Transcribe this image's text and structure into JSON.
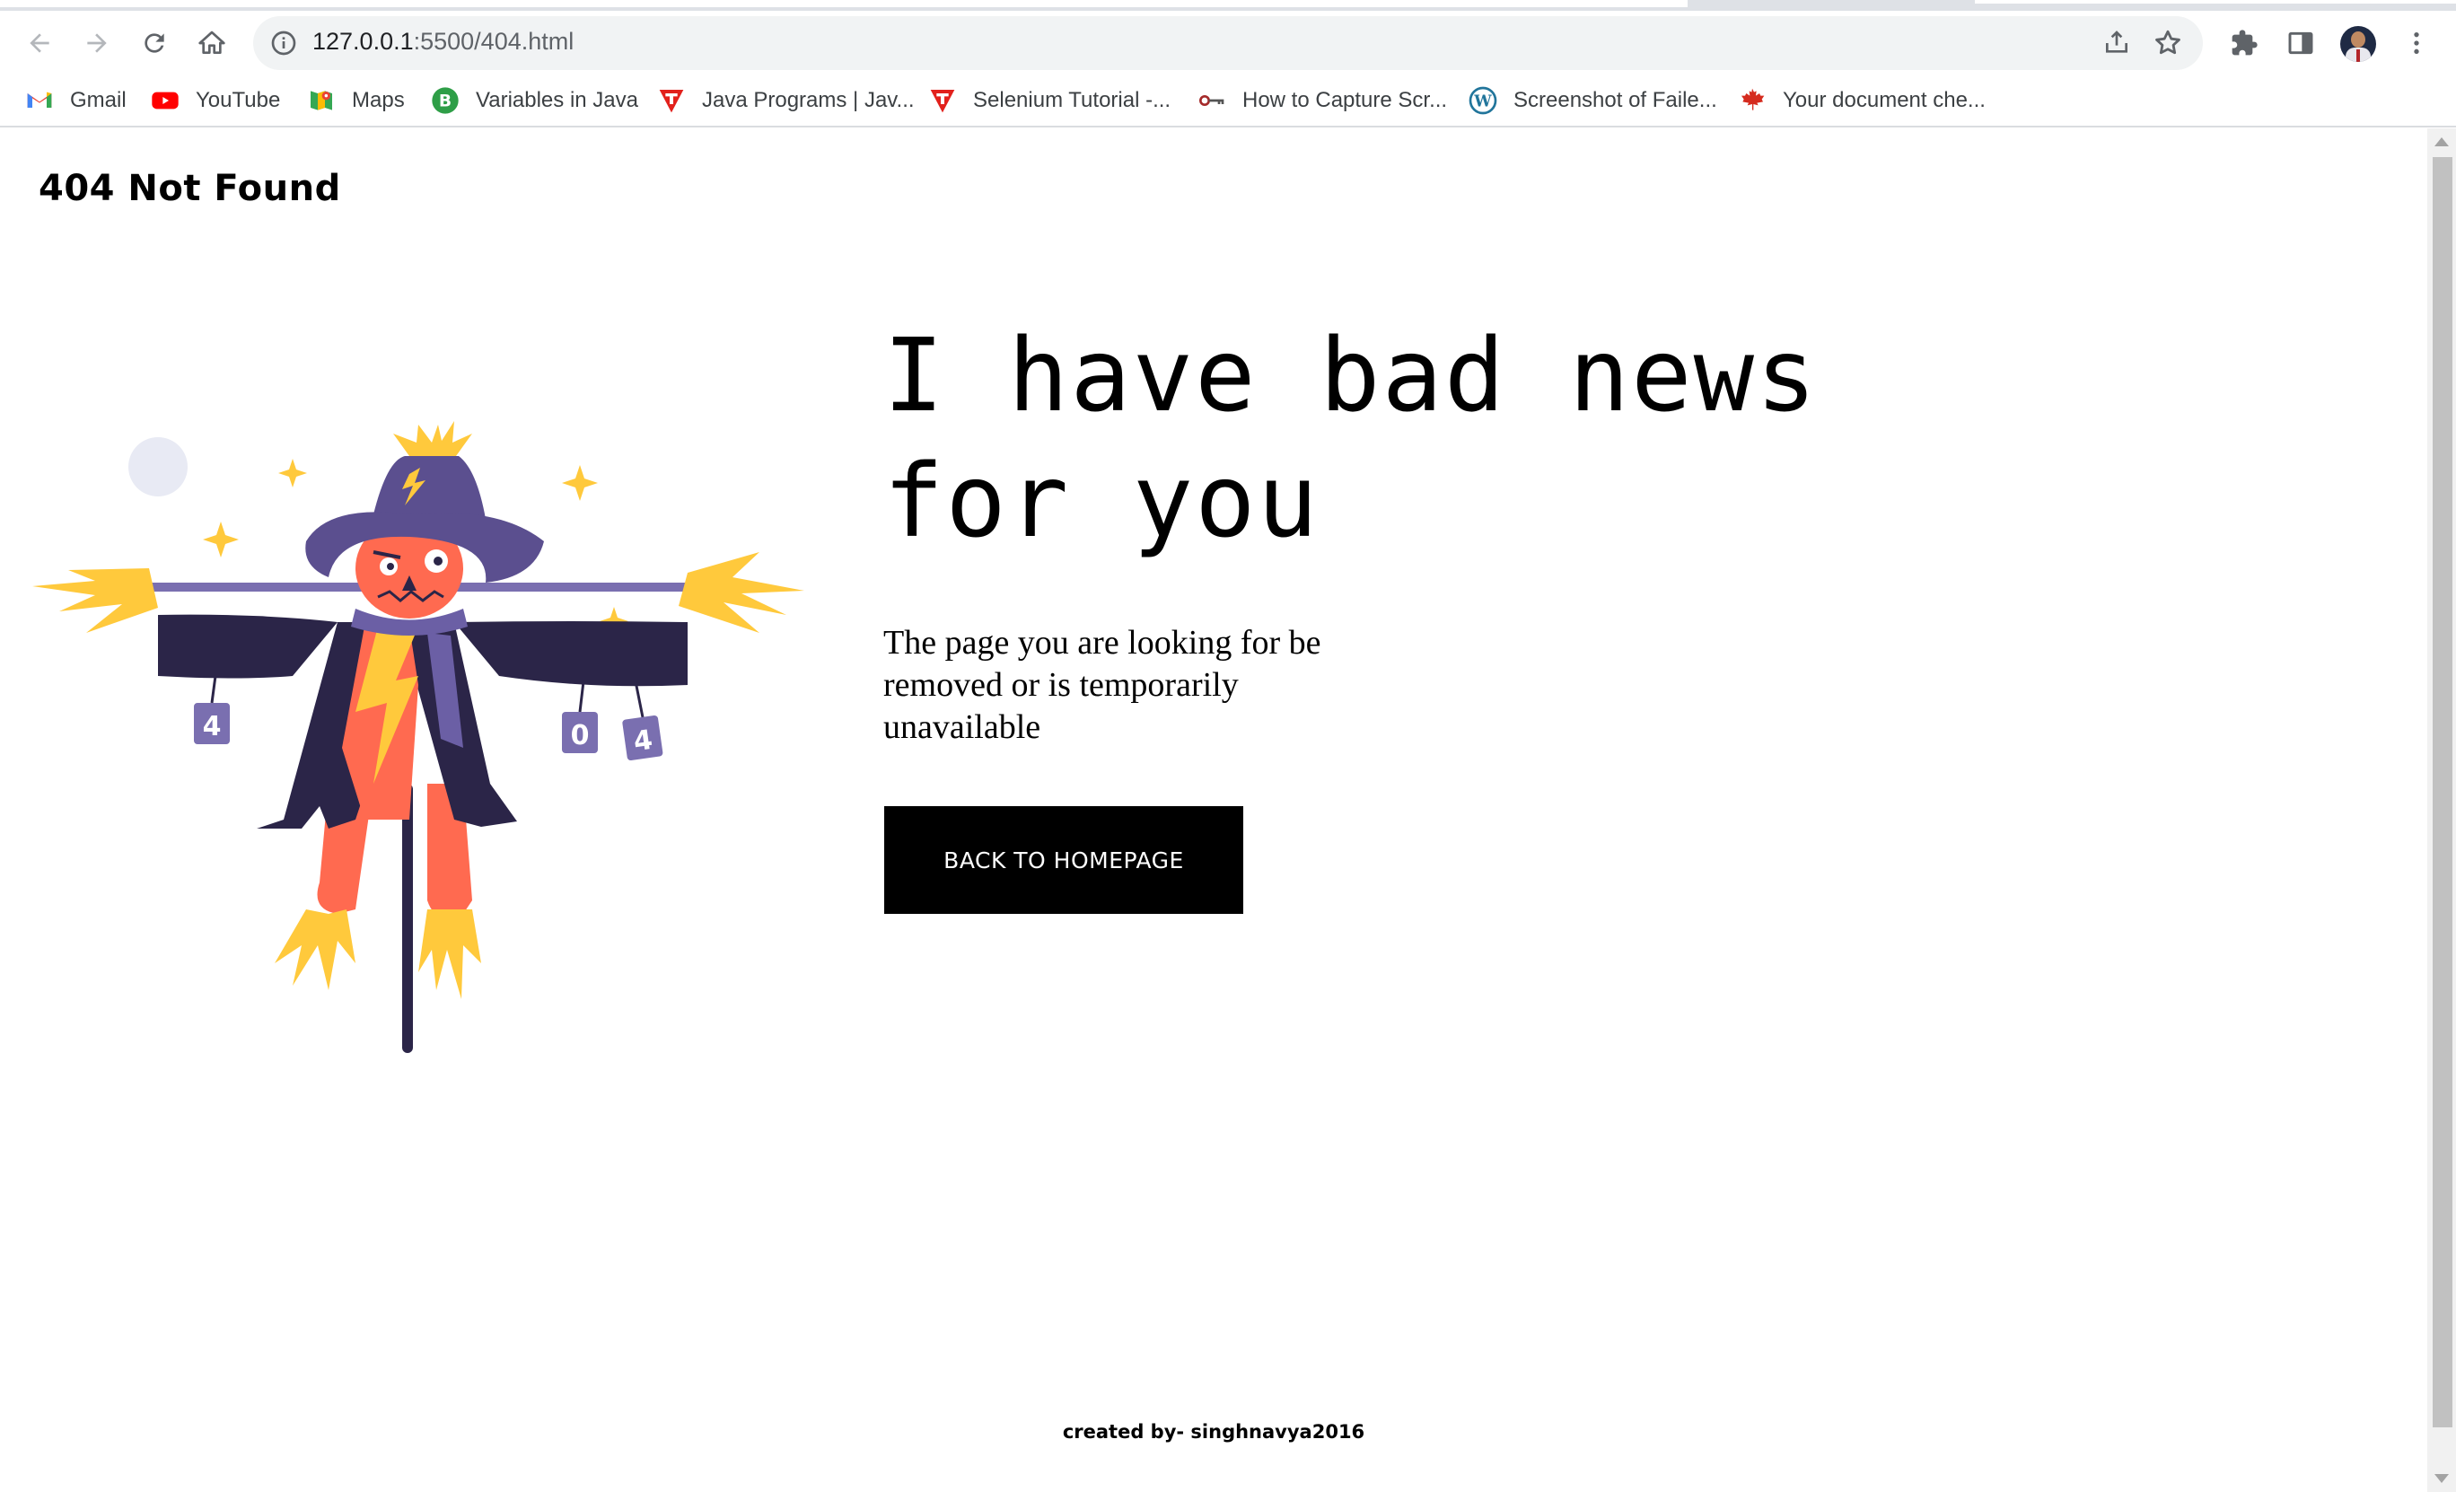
{
  "browser": {
    "url_host": "127.0.0.1",
    "url_rest": ":5500/404.html",
    "bookmarks": [
      {
        "label": "Gmail",
        "icon": "gmail-icon"
      },
      {
        "label": "YouTube",
        "icon": "youtube-icon"
      },
      {
        "label": "Maps",
        "icon": "maps-icon"
      },
      {
        "label": "Variables in Java",
        "icon": "variables-site-icon"
      },
      {
        "label": "Java Programs | Jav...",
        "icon": "t-site-icon"
      },
      {
        "label": "Selenium Tutorial -...",
        "icon": "t-site-icon"
      },
      {
        "label": "How to Capture Scr...",
        "icon": "key-site-icon"
      },
      {
        "label": "Screenshot of Faile...",
        "icon": "wordpress-icon"
      },
      {
        "label": "Your document che...",
        "icon": "maple-leaf-icon"
      }
    ]
  },
  "page": {
    "brand": "404 Not Found",
    "headline_line1": "I have bad news",
    "headline_line2": "for you",
    "description": "The page you are looking for be removed or is temporarily unavailable",
    "cta_label": "BACK TO HOMEPAGE",
    "footer": "created by- singhnavya2016",
    "illustration": {
      "subject": "scarecrow",
      "can_labels": [
        "4",
        "0",
        "4"
      ]
    }
  },
  "colors": {
    "accent_button": "#000000",
    "scarecrow_hat": "#5b4f8f",
    "scarecrow_face": "#ff6a50",
    "scarecrow_coat": "#2b2548",
    "straw": "#ffc93c"
  }
}
